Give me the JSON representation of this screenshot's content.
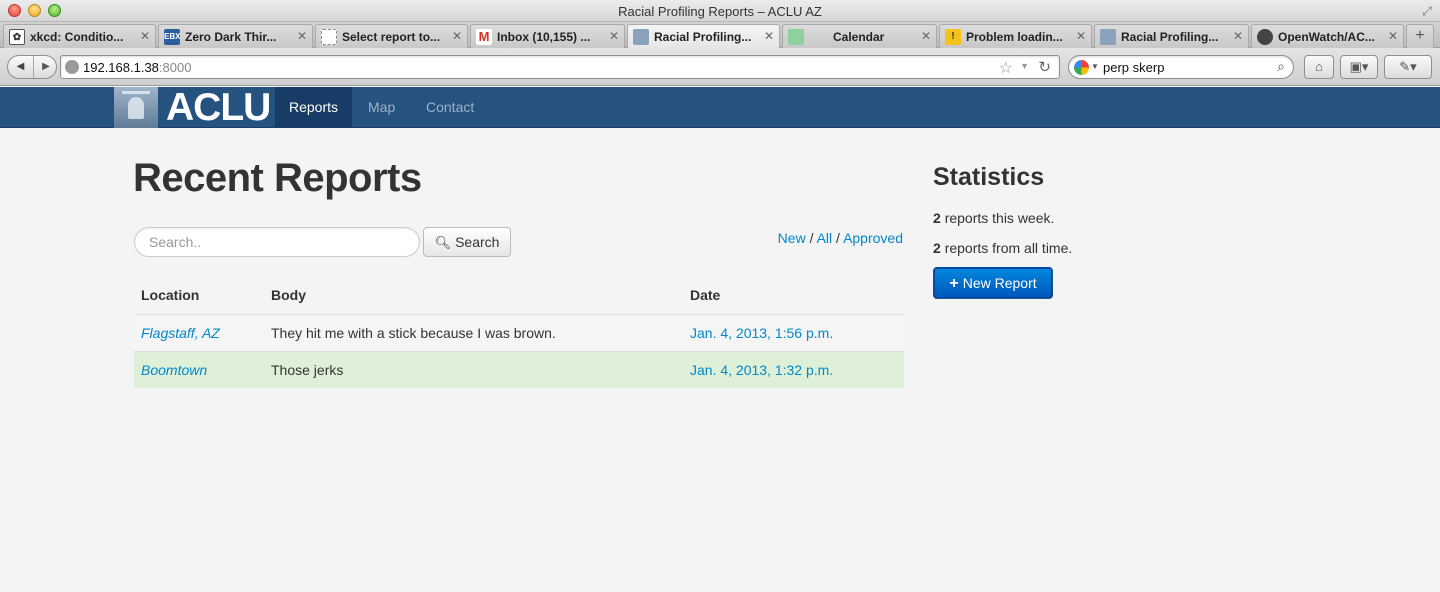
{
  "window": {
    "title": "Racial Profiling Reports – ACLU AZ"
  },
  "tabs": [
    {
      "label": "xkcd: Conditio...",
      "icon": "xkcd-favicon"
    },
    {
      "label": "Zero Dark Thir...",
      "icon": "ebx-favicon",
      "icon_text": "EBX"
    },
    {
      "label": "Select report to...",
      "icon": "blank-page-favicon"
    },
    {
      "label": "Inbox (10,155) ...",
      "icon": "gmail-favicon",
      "icon_text": "M"
    },
    {
      "label": "Racial Profiling...",
      "icon": "aclu-favicon",
      "active": true
    },
    {
      "label": "Calendar",
      "icon": "calendar-favicon"
    },
    {
      "label": "Problem loadin...",
      "icon": "warning-favicon",
      "icon_text": "!"
    },
    {
      "label": "Racial Profiling...",
      "icon": "aclu-favicon"
    },
    {
      "label": "OpenWatch/AC...",
      "icon": "github-favicon"
    }
  ],
  "toolbar": {
    "url_host": "192.168.1.38",
    "url_port": ":8000",
    "search_value": "perp skerp"
  },
  "site": {
    "logo_text": "ACLU",
    "nav": [
      {
        "label": "Reports",
        "active": true
      },
      {
        "label": "Map"
      },
      {
        "label": "Contact"
      }
    ]
  },
  "main": {
    "title": "Recent Reports",
    "search_placeholder": "Search..",
    "search_button": "Search",
    "filters": {
      "new": "New",
      "all": "All",
      "approved": "Approved",
      "sep": "/"
    },
    "table": {
      "headers": {
        "location": "Location",
        "body": "Body",
        "date": "Date"
      },
      "rows": [
        {
          "location": "Flagstaff, AZ",
          "body": "They hit me with a stick because I was brown.",
          "date": "Jan. 4, 2013, 1:56 p.m."
        },
        {
          "location": "Boomtown",
          "body": "Those jerks",
          "date": "Jan. 4, 2013, 1:32 p.m."
        }
      ]
    }
  },
  "sidebar": {
    "title": "Statistics",
    "week_count": "2",
    "week_text": "reports this week.",
    "all_count": "2",
    "all_text": "reports from all time.",
    "new_report_button": "New Report"
  },
  "colors": {
    "nav_bg": "#25527f",
    "nav_active_bg": "#173d66",
    "link": "#0088cc",
    "success_row": "#dff0d8",
    "primary_button": "#0066cc"
  }
}
